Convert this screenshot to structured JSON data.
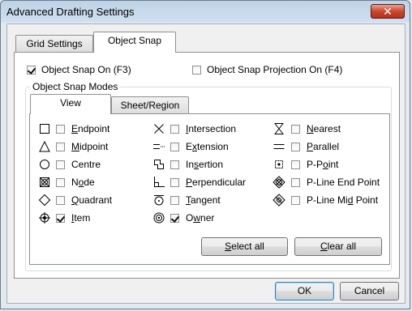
{
  "window": {
    "title": "Advanced Drafting Settings",
    "close_glyph": "✕"
  },
  "tabs": [
    {
      "label": "Grid Settings",
      "active": false
    },
    {
      "label": "Object Snap",
      "active": true
    }
  ],
  "options": {
    "snap_on": {
      "label": "Object Snap On (F3)",
      "checked": true
    },
    "snap_projection": {
      "label": "Object Snap Projection On (F4)",
      "checked": false
    }
  },
  "modes_group": {
    "title": "Object Snap Modes",
    "tabs": [
      {
        "label": "View",
        "active": true
      },
      {
        "label": "Sheet/Region",
        "active": false
      }
    ]
  },
  "snap_modes": {
    "col1": [
      {
        "pre": "",
        "key": "E",
        "post": "ndpoint",
        "icon": "square-icon",
        "checked": false
      },
      {
        "pre": "",
        "key": "M",
        "post": "idpoint",
        "icon": "triangle-icon",
        "checked": false
      },
      {
        "pre": "Centre",
        "key": "",
        "post": "",
        "icon": "circle-icon",
        "checked": false
      },
      {
        "pre": "N",
        "key": "o",
        "post": "de",
        "icon": "node-icon",
        "checked": false
      },
      {
        "pre": "",
        "key": "Q",
        "post": "uadrant",
        "icon": "diamond-icon",
        "checked": false
      },
      {
        "pre": "",
        "key": "I",
        "post": "tem",
        "icon": "item-icon",
        "checked": true
      }
    ],
    "col2": [
      {
        "pre": "",
        "key": "I",
        "post": "ntersection",
        "icon": "x-icon",
        "checked": false
      },
      {
        "pre": "E",
        "key": "x",
        "post": "tension",
        "icon": "extension-icon",
        "checked": false
      },
      {
        "pre": "In",
        "key": "s",
        "post": "ertion",
        "icon": "insertion-icon",
        "checked": false
      },
      {
        "pre": "",
        "key": "P",
        "post": "erpendicular",
        "icon": "perpendicular-icon",
        "checked": false
      },
      {
        "pre": "",
        "key": "T",
        "post": "angent",
        "icon": "tangent-icon",
        "checked": false
      },
      {
        "pre": "O",
        "key": "w",
        "post": "ner",
        "icon": "owner-icon",
        "checked": true
      }
    ],
    "col3": [
      {
        "pre": "",
        "key": "N",
        "post": "earest",
        "icon": "hourglass-icon",
        "checked": false
      },
      {
        "pre": "",
        "key": "P",
        "post": "arallel",
        "icon": "parallel-icon",
        "checked": false
      },
      {
        "pre": "P-P",
        "key": "o",
        "post": "int",
        "icon": "point-icon",
        "checked": false
      },
      {
        "pre": "P-Line End Point",
        "key": "",
        "post": "",
        "icon": "pline-end-icon",
        "checked": false
      },
      {
        "pre": "P-Line Mi",
        "key": "d",
        "post": " Point",
        "icon": "pline-mid-icon",
        "checked": false
      }
    ]
  },
  "buttons": {
    "select_all": {
      "pre": "",
      "key": "S",
      "post": "elect all"
    },
    "clear_all": {
      "pre": "",
      "key": "C",
      "post": "lear all"
    },
    "ok": "OK",
    "cancel": "Cancel"
  }
}
